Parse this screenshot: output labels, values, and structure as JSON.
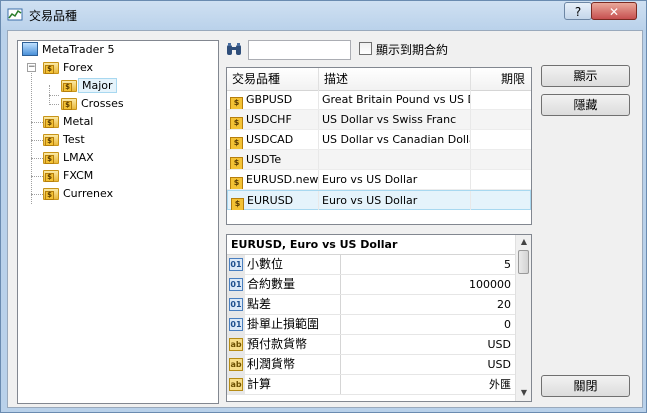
{
  "window": {
    "title": "交易品種",
    "help_label": "?",
    "close_label": "✕"
  },
  "tree": {
    "root": "MetaTrader 5",
    "forex": "Forex",
    "major": "Major",
    "crosses": "Crosses",
    "metal": "Metal",
    "test": "Test",
    "lmax": "LMAX",
    "fxcm": "FXCM",
    "currenex": "Currenex"
  },
  "search": {
    "value": "",
    "checkbox_label": "顯示到期合約"
  },
  "symbols": {
    "headers": [
      "交易品種",
      "描述",
      "期限"
    ],
    "rows": [
      {
        "symbol": "GBPUSD",
        "description": "Great Britain Pound vs US D...",
        "expiry": ""
      },
      {
        "symbol": "USDCHF",
        "description": "US Dollar vs Swiss Franc",
        "expiry": ""
      },
      {
        "symbol": "USDCAD",
        "description": "US Dollar vs Canadian Dollar",
        "expiry": ""
      },
      {
        "symbol": "USDTe",
        "description": "",
        "expiry": ""
      },
      {
        "symbol": "EURUSD.new",
        "description": "Euro vs US Dollar",
        "expiry": ""
      },
      {
        "symbol": "EURUSD",
        "description": "Euro vs US Dollar",
        "expiry": ""
      }
    ]
  },
  "properties": {
    "header": "EURUSD, Euro vs US Dollar",
    "rows": [
      {
        "icon": "01",
        "name": "小數位",
        "value": "5"
      },
      {
        "icon": "01",
        "name": "合約數量",
        "value": "100000"
      },
      {
        "icon": "01",
        "name": "點差",
        "value": "20"
      },
      {
        "icon": "01",
        "name": "掛單止損範圍",
        "value": "0"
      },
      {
        "icon": "ab",
        "name": "預付款貨幣",
        "value": "USD"
      },
      {
        "icon": "ab",
        "name": "利潤貨幣",
        "value": "USD"
      },
      {
        "icon": "ab",
        "name": "計算",
        "value": "外匯"
      }
    ]
  },
  "buttons": {
    "show": "顯示",
    "hide": "隱藏",
    "close": "關閉"
  }
}
